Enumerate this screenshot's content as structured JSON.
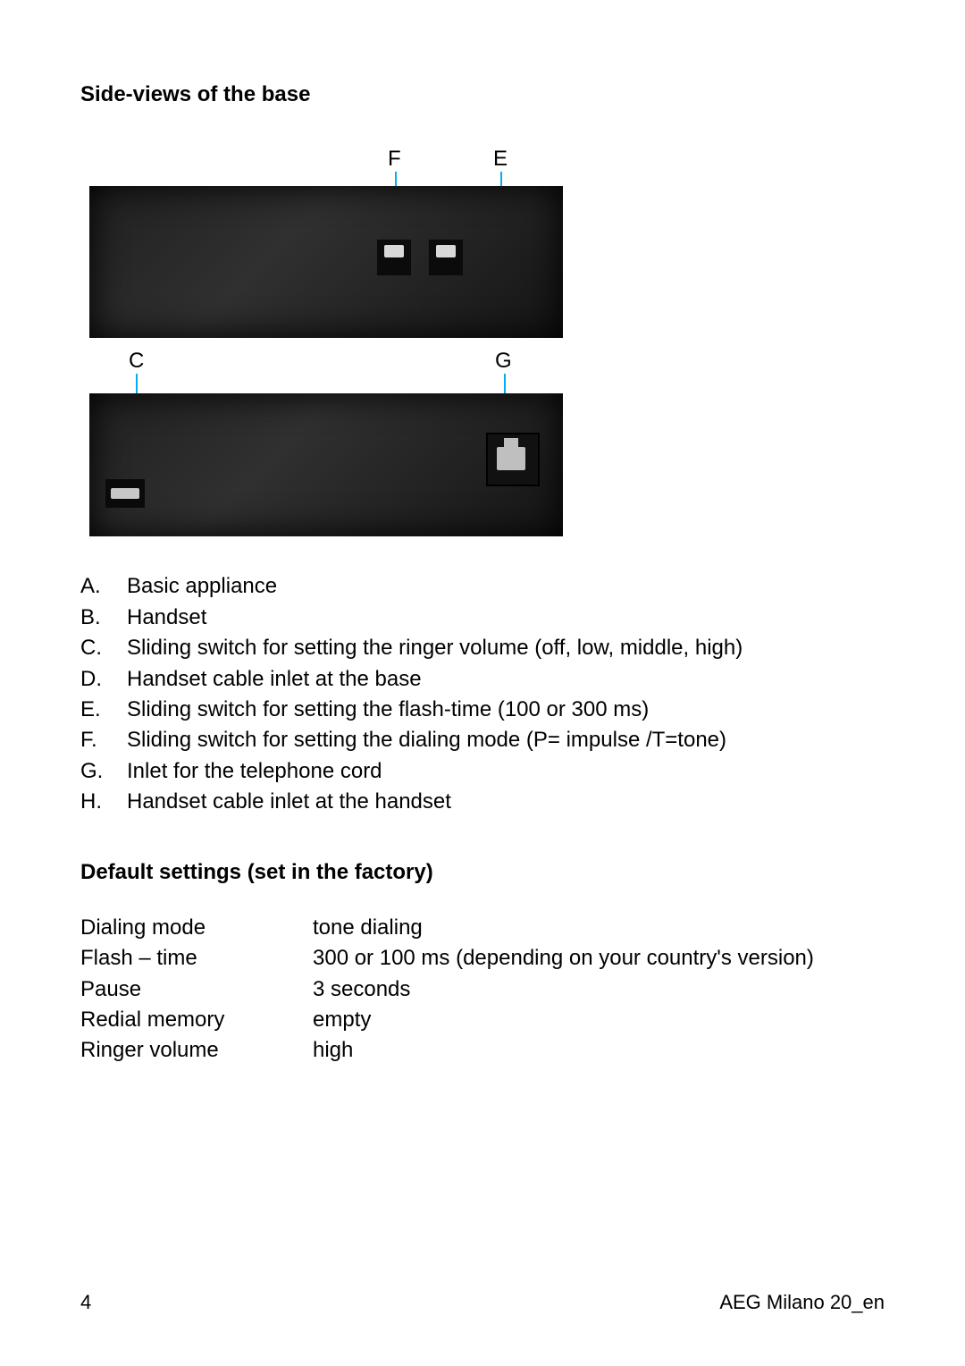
{
  "section1_title": "Side-views of the base",
  "figure": {
    "top": {
      "F": "F",
      "E": "E"
    },
    "mid": {
      "C": "C",
      "G": "G"
    }
  },
  "legend": [
    {
      "letter": "A.",
      "text": "Basic appliance"
    },
    {
      "letter": "B.",
      "text": "Handset"
    },
    {
      "letter": "C.",
      "text": "Sliding switch for setting the ringer volume (off, low, middle, high)"
    },
    {
      "letter": "D.",
      "text": "Handset cable inlet at the base"
    },
    {
      "letter": "E.",
      "text": "Sliding switch for setting the flash-time (100 or 300 ms)"
    },
    {
      "letter": "F.",
      "text": "Sliding switch for setting the dialing mode (P= impulse /T=tone)"
    },
    {
      "letter": "G.",
      "text": "Inlet for the telephone cord"
    },
    {
      "letter": "H.",
      "text": "Handset cable inlet at the handset"
    }
  ],
  "section2_title": "Default settings (set in the factory)",
  "settings": [
    {
      "label": "Dialing mode",
      "value": "tone dialing"
    },
    {
      "label": "Flash – time",
      "value": "300 or 100 ms (depending on your country's version)"
    },
    {
      "label": "Pause",
      "value": "3 seconds"
    },
    {
      "label": "Redial memory",
      "value": "empty"
    },
    {
      "label": "Ringer volume",
      "value": "high"
    }
  ],
  "footer": {
    "page": "4",
    "doc": "AEG Milano 20_en"
  }
}
